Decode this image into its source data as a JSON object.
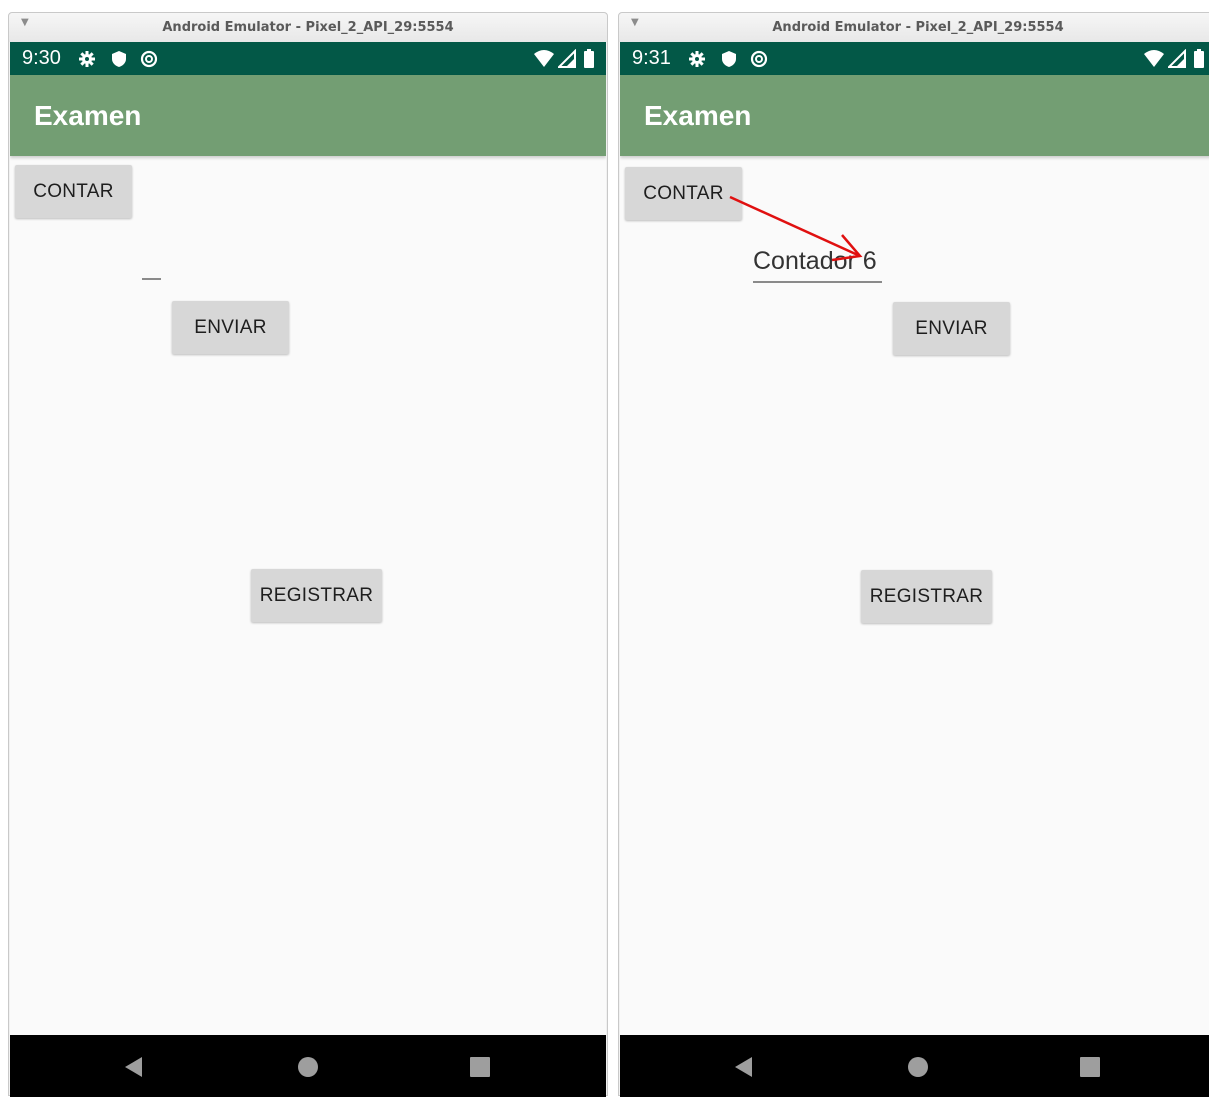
{
  "windows": [
    {
      "title": "Android Emulator - Pixel_2_API_29:5554",
      "status": {
        "time": "9:30"
      },
      "app_title": "Examen",
      "buttons": {
        "contar": "CONTAR",
        "enviar": "ENVIAR",
        "registrar": "REGISTRAR"
      },
      "field_value": ""
    },
    {
      "title": "Android Emulator - Pixel_2_API_29:5554",
      "status": {
        "time": "9:31"
      },
      "app_title": "Examen",
      "buttons": {
        "contar": "CONTAR",
        "enviar": "ENVIAR",
        "registrar": "REGISTRAR"
      },
      "field_value": "Contador 6"
    }
  ],
  "icons": [
    "gear-icon",
    "shield-icon",
    "data-saver-icon",
    "wifi-icon",
    "cell-signal-icon",
    "battery-icon",
    "back-icon",
    "home-icon",
    "recents-icon",
    "collapse-arrow-icon"
  ],
  "colors": {
    "status_bar": "#035847",
    "app_bar": "#739e73",
    "button": "#d7d7d7",
    "annotation_arrow": "#e01010"
  }
}
